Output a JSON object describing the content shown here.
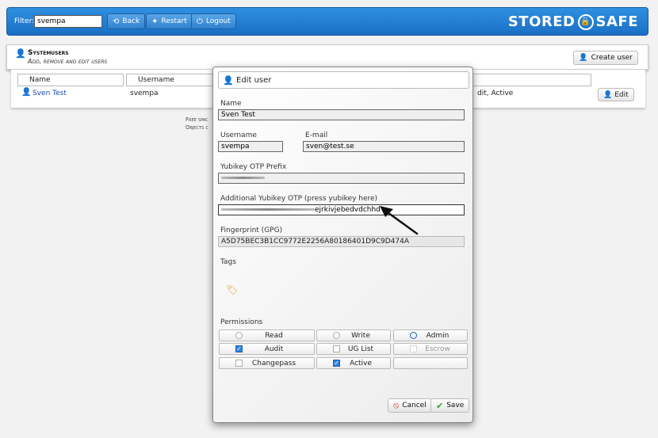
{
  "topbar": {
    "filter_label": "Filter:",
    "filter_value": "svempa",
    "back_label": "Back",
    "restart_label": "Restart",
    "logout_label": "Logout",
    "logo_left": "STORED",
    "logo_right": "SAFE",
    "bar_color": "#1a6fc4"
  },
  "panel": {
    "title": "Systemusers",
    "subtitle": "Add, remove and edit users",
    "create_label": "Create user"
  },
  "list": {
    "headers": [
      "Name",
      "Username"
    ],
    "rows": [
      {
        "name": "Sven Test",
        "username": "svempa",
        "status": "dit, Active",
        "edit_label": "Edit"
      }
    ],
    "free_text_1": "Free spac",
    "free_text_2": "Objects c"
  },
  "modal": {
    "title": "Edit user",
    "name_label": "Name",
    "name_value": "Sven Test",
    "username_label": "Username",
    "username_value": "svempa",
    "email_label": "E-mail",
    "email_value": "sven@test.se",
    "otp_prefix_label": "Yubikey OTP Prefix",
    "otp_additional_label": "Additional Yubikey OTP (press yubikey here)",
    "otp_additional_value": "ejrkivjebedvdchhd",
    "fingerprint_label": "Fingerprint (GPG)",
    "fingerprint_value": "A5D75BEC3B1CC9772E2256A80186401D9C9D474A",
    "tags_label": "Tags",
    "permissions_label": "Permissions",
    "permissions": {
      "read": {
        "label": "Read",
        "checked": false
      },
      "write": {
        "label": "Write",
        "checked": false
      },
      "admin": {
        "label": "Admin",
        "checked": true
      },
      "audit": {
        "label": "Audit",
        "checked": true
      },
      "uglist": {
        "label": "UG List",
        "checked": false
      },
      "escrow": {
        "label": "Escrow",
        "checked": false,
        "disabled": true
      },
      "changepass": {
        "label": "Changepass",
        "checked": false
      },
      "active": {
        "label": "Active",
        "checked": true
      }
    },
    "cancel_label": "Cancel",
    "save_label": "Save"
  },
  "icons": [
    "back-icon",
    "restart-icon",
    "logout-icon",
    "lock-icon",
    "user-icon",
    "create-user-icon",
    "edit-user-icon",
    "tag-icon",
    "cancel-icon",
    "save-check-icon",
    "arrow-pointer-icon"
  ]
}
